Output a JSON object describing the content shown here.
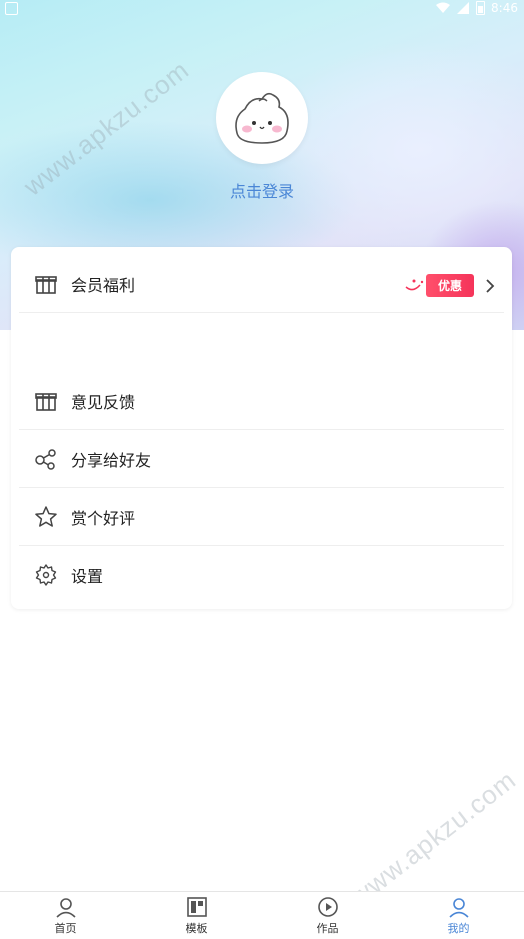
{
  "status_bar": {
    "time": "8:46"
  },
  "profile": {
    "login_label": "点击登录"
  },
  "menu": {
    "vip": {
      "label": "会员福利",
      "badge": "优惠"
    },
    "items": [
      {
        "label": "意见反馈",
        "icon": "gift-icon"
      },
      {
        "label": "分享给好友",
        "icon": "share-icon"
      },
      {
        "label": "赏个好评",
        "icon": "star-icon"
      },
      {
        "label": "设置",
        "icon": "gear-icon"
      }
    ]
  },
  "watermark": "www.apkzu.com",
  "tabs": [
    {
      "label": "首页",
      "icon": "home-icon"
    },
    {
      "label": "模板",
      "icon": "template-icon"
    },
    {
      "label": "作品",
      "icon": "play-icon"
    },
    {
      "label": "我的",
      "icon": "user-icon",
      "active": true
    }
  ],
  "colors": {
    "accent": "#4a86d6",
    "badge": "#f5345a"
  }
}
